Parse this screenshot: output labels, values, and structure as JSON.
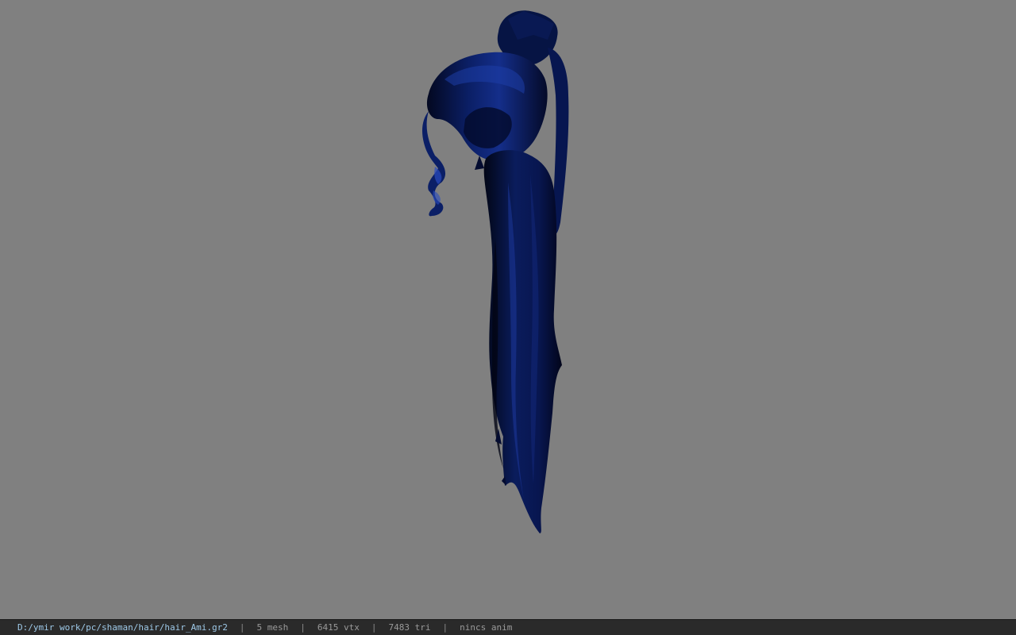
{
  "viewport": {
    "background_color": "#808080",
    "model_color": "#0b1f66",
    "model_highlight_color": "#1d3ea8",
    "model_shadow_color": "#030820"
  },
  "status_bar": {
    "file_path": "D:/ymir work/pc/shaman/hair/hair_Ami.gr2",
    "separator": "|",
    "mesh_count": "5 mesh",
    "vertex_count": "6415 vtx",
    "triangle_count": "7483 tri",
    "anim_status": "nincs anim",
    "path_color": "#9ec9e8",
    "text_color": "#9a9a9a",
    "background_color": "#2a2a2a"
  }
}
